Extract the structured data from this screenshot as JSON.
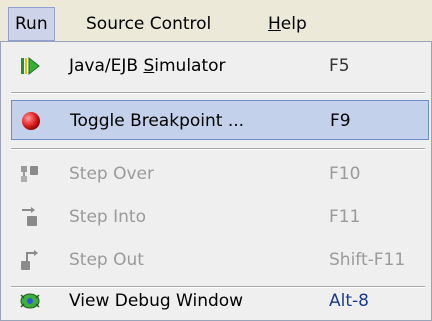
{
  "menubar": {
    "run": "Run",
    "source_control": "Source Control",
    "help_prefix": "",
    "help_mnemonic": "H",
    "help_rest": "elp"
  },
  "menu": {
    "items": [
      {
        "label_pre": "Java/EJB ",
        "mnemonic": "S",
        "label_post": "imulator",
        "shortcut": "F5",
        "icon": "play-arrow-icon",
        "enabled": true
      },
      {
        "label_pre": "Toggle Breakpoint ...",
        "mnemonic": "",
        "label_post": "",
        "shortcut": "F9",
        "icon": "breakpoint-red-dot-icon",
        "enabled": true,
        "selected": true
      },
      {
        "label_pre": "Step Over",
        "mnemonic": "",
        "label_post": "",
        "shortcut": "F10",
        "icon": "step-over-icon",
        "enabled": false
      },
      {
        "label_pre": "Step Into",
        "mnemonic": "",
        "label_post": "",
        "shortcut": "F11",
        "icon": "step-into-icon",
        "enabled": false
      },
      {
        "label_pre": "Step Out",
        "mnemonic": "",
        "label_post": "",
        "shortcut": "Shift-F11",
        "icon": "step-out-icon",
        "enabled": false
      },
      {
        "label_pre": "View Debug Window",
        "mnemonic": "",
        "label_post": "",
        "shortcut": "Alt-8",
        "icon": "debug-window-icon",
        "enabled": true
      }
    ]
  },
  "colors": {
    "selected_bg": "#c3d2ea",
    "disabled_text": "#9a9a9a",
    "breakpoint_red": "#e02020"
  }
}
